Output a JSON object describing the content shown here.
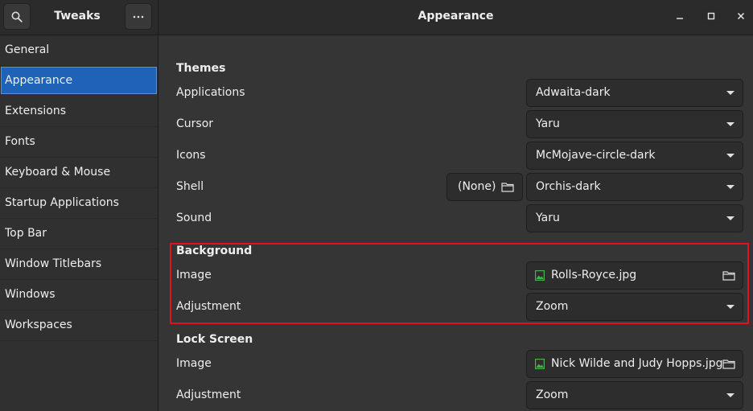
{
  "header": {
    "app_title": "Tweaks",
    "page_title": "Appearance",
    "search_icon": "search-icon",
    "menu_icon": "more-icon"
  },
  "sidebar": {
    "items": [
      {
        "label": "General"
      },
      {
        "label": "Appearance",
        "active": true
      },
      {
        "label": "Extensions"
      },
      {
        "label": "Fonts"
      },
      {
        "label": "Keyboard & Mouse"
      },
      {
        "label": "Startup Applications"
      },
      {
        "label": "Top Bar"
      },
      {
        "label": "Window Titlebars"
      },
      {
        "label": "Windows"
      },
      {
        "label": "Workspaces"
      }
    ]
  },
  "themes": {
    "title": "Themes",
    "applications": {
      "label": "Applications",
      "value": "Adwaita-dark"
    },
    "cursor": {
      "label": "Cursor",
      "value": "Yaru"
    },
    "icons": {
      "label": "Icons",
      "value": "McMojave-circle-dark"
    },
    "shell": {
      "label": "Shell",
      "file_value": "(None)",
      "value": "Orchis-dark"
    },
    "sound": {
      "label": "Sound",
      "value": "Yaru"
    }
  },
  "background": {
    "title": "Background",
    "image": {
      "label": "Image",
      "value": "Rolls-Royce.jpg"
    },
    "adjustment": {
      "label": "Adjustment",
      "value": "Zoom"
    }
  },
  "lock_screen": {
    "title": "Lock Screen",
    "image": {
      "label": "Image",
      "value": "Nick Wilde and Judy Hopps.jpg"
    },
    "adjustment": {
      "label": "Adjustment",
      "value": "Zoom"
    }
  },
  "colors": {
    "accent": "#1e63b8",
    "highlight_box": "#e0121b"
  }
}
